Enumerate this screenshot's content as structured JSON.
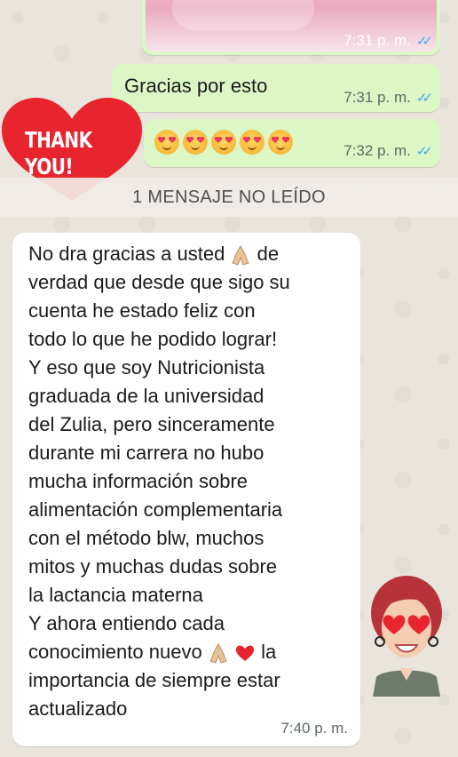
{
  "messages": {
    "image_message": {
      "time": "7:31 p. m.",
      "ticks": "✓✓"
    },
    "gracias": {
      "text": "Gracias por esto",
      "time": "7:31 p. m.",
      "ticks": "✓✓"
    },
    "emoji_message": {
      "emoji_name": "smiling-face-with-hearts",
      "count": 5,
      "time": "7:32 p. m.",
      "ticks": "✓✓"
    },
    "sticker_heart": {
      "text": "THANK YOU!",
      "color": "#e8242e"
    },
    "unread_divider": "1 MENSAJE NO LEÍDO",
    "incoming": {
      "lines": [
        "No dra gracias a usted",
        "verdad que desde que sigo su",
        "cuenta he estado feliz con",
        "todo lo que he podido lograr!",
        "Y eso que soy Nutricionista",
        "graduada de la universidad",
        "del Zulia, pero sinceramente",
        "durante mi carrera no hubo",
        "mucha información sobre",
        "alimentación complementaria",
        "con el método blw, muchos",
        "mitos y muchas dudas sobre",
        "la lactancia materna",
        "Y ahora entiendo cada",
        "conocimiento nuevo",
        "importancia de siempre estar",
        "actualizado"
      ],
      "line1_tail": "de",
      "line15_tail": "la",
      "time": "7:40 p. m."
    }
  },
  "colors": {
    "outgoing_bubble": "#dcf7c6",
    "incoming_bubble": "#ffffff",
    "tick_read": "#4aa6e8",
    "background": "#e9e4dc"
  },
  "icons": [
    "folded-hands-emoji",
    "red-heart-emoji",
    "smiling-face-with-hearts-emoji",
    "read-ticks-icon"
  ]
}
